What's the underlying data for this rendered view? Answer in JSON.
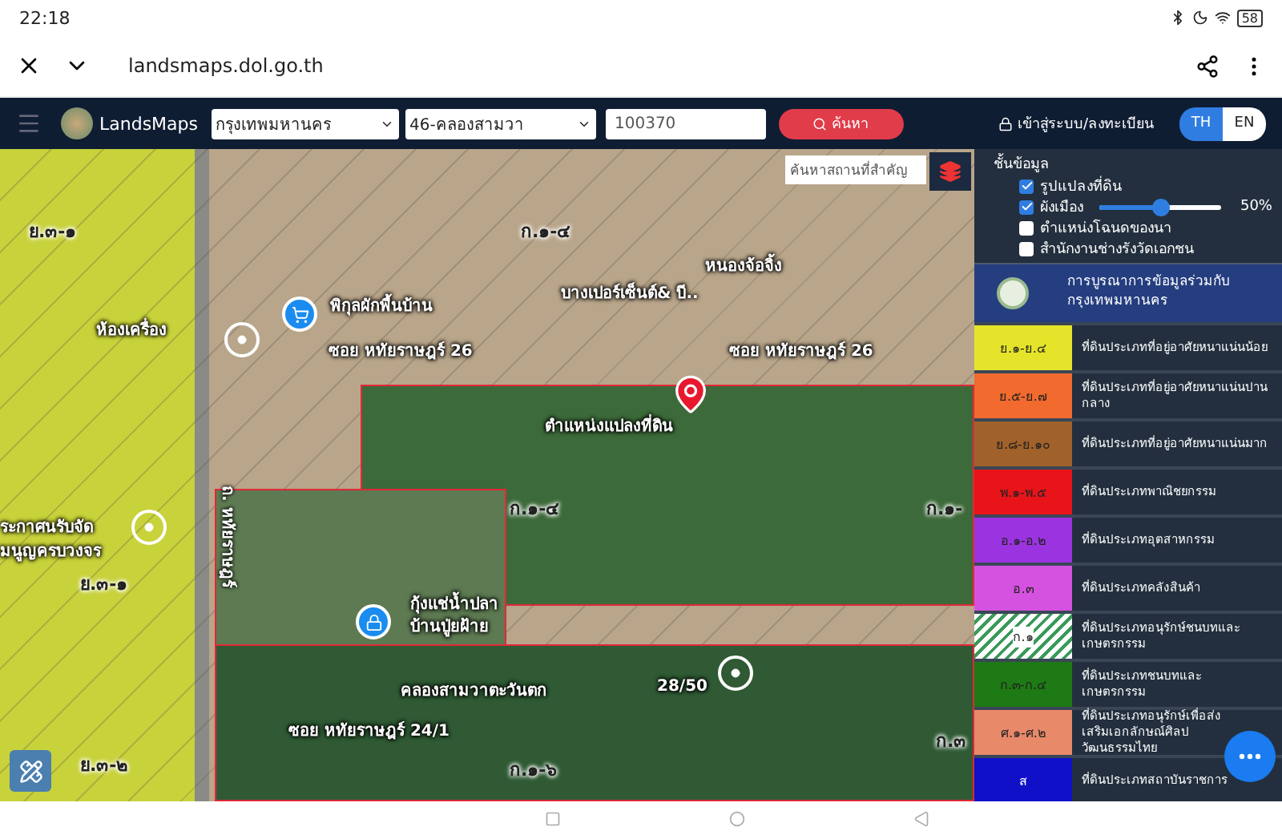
{
  "status_bar": {
    "time": "22:18",
    "battery": "58"
  },
  "browser": {
    "url": "landsmaps.dol.go.th"
  },
  "app_bar": {
    "brand": "LandsMaps",
    "province": "กรุงเทพมหานคร",
    "district": "46-คลองสามวา",
    "parcel_number": "100370",
    "search_button": "ค้นหา",
    "login": "เข้าสู่ระบบ/ลงทะเบียน",
    "languages": [
      {
        "label": "TH",
        "selected": true
      },
      {
        "label": "EN",
        "selected": false
      }
    ]
  },
  "map": {
    "place_search": {
      "placeholder": "ค้นหาสถานที่สำคัญ"
    },
    "labels": [
      {
        "text": "ย.๓-๑",
        "kind": "zone"
      },
      {
        "text": "ก.๑-๔",
        "kind": "zone"
      },
      {
        "text": "ห้องเครื่อง",
        "kind": "place"
      },
      {
        "text": "พิกุลผักพื้นบ้าน",
        "kind": "place"
      },
      {
        "text": "หนองจ้อจิ้ง",
        "kind": "place"
      },
      {
        "text": "บางเปอร์เซ็นต์& บี..",
        "kind": "place"
      },
      {
        "text": "ซอย หทัยราษฎร์ 26",
        "kind": "road"
      },
      {
        "text": "ซอย หทัยราษฎร์ 26",
        "kind": "road"
      },
      {
        "text": "ตำแหน่งแปลงที่ดิน",
        "kind": "place"
      },
      {
        "text": "ระกาศนรับจัด",
        "kind": "place"
      },
      {
        "text": "มนูญครบวงจร",
        "kind": "place"
      },
      {
        "text": "ย.๓-๑",
        "kind": "zone"
      },
      {
        "text": "ก.๑-๔",
        "kind": "zone"
      },
      {
        "text": "ก.๑-",
        "kind": "zone"
      },
      {
        "text": "กุ้งแช่น้ำปลา",
        "kind": "place"
      },
      {
        "text": "บ้านปู่ยฝ้าย",
        "kind": "place"
      },
      {
        "text": "คลองสามวาตะวันตก",
        "kind": "place"
      },
      {
        "text": "28/50",
        "kind": "place"
      },
      {
        "text": "ซอย หทัยราษฎร์ 24/1",
        "kind": "road"
      },
      {
        "text": "ย.๓-๒",
        "kind": "zone"
      },
      {
        "text": "ก.๑-๖",
        "kind": "zone"
      },
      {
        "text": "ก.๓",
        "kind": "zone"
      }
    ],
    "road_label": "ถ. หทัยราษฎร์"
  },
  "layers": {
    "title": "ชั้นข้อมูล",
    "opacity_reading": "50%",
    "items": [
      {
        "label": "รูปแปลงที่ดิน",
        "checked": true,
        "kind": "check"
      },
      {
        "label": "ผังเมือง",
        "checked": true,
        "kind": "slider",
        "level": 0.5
      },
      {
        "label": "ตำแหน่งโฉนดของนา",
        "checked": false,
        "kind": "check"
      },
      {
        "label": "สำนักงานช่างรังวัดเอกชน",
        "checked": false,
        "kind": "check"
      }
    ]
  },
  "legend": {
    "title": "การบูรณาการข้อมูลร่วมกับ กรุงเทพมหานคร",
    "rows": [
      {
        "code": "ย.๑-ย.๔",
        "label": "ที่ดินประเภทที่อยู่อาศัยหนาแน่นน้อย",
        "color": "#e6e42a",
        "kind": "solid"
      },
      {
        "code": "ย.๕-ย.๗",
        "label": "ที่ดินประเภทที่อยู่อาศัยหนาแน่นปานกลาง",
        "color": "#f26a2e",
        "kind": "solid"
      },
      {
        "code": "ย.๘-ย.๑๐",
        "label": "ที่ดินประเภทที่อยู่อาศัยหนาแน่นมาก",
        "color": "#a0612a",
        "kind": "solid"
      },
      {
        "code": "พ.๑-พ.๕",
        "label": "ที่ดินประเภทพาณิชยกรรม",
        "color": "#e8141a",
        "kind": "solid"
      },
      {
        "code": "อ.๑-อ.๒",
        "label": "ที่ดินประเภทอุตสาหกรรม",
        "color": "#9b34e0",
        "kind": "solid"
      },
      {
        "code": "อ.๓",
        "label": "ที่ดินประเภทคลังสินค้า",
        "color": "#d552e0",
        "kind": "solid"
      },
      {
        "code": "ก.๑",
        "label": "ที่ดินประเภทอนุรักษ์ชนบทและเกษตรกรรม",
        "color": "#3a9a5a",
        "kind": "hatched"
      },
      {
        "code": "ก.๓-ก.๔",
        "label": "ที่ดินประเภทชนบทและเกษตรกรรม",
        "color": "#1e7a14",
        "kind": "solid"
      },
      {
        "code": "ศ.๑-ศ.๒",
        "label": "ที่ดินประเภทอนุรักษ์เพื่อส่งเสริมเอกลักษณ์ศิลปวัฒนธรรมไทย",
        "color": "#e8896a",
        "kind": "solid"
      },
      {
        "code": "ส",
        "label": "ที่ดินประเภทสถาบันราชการ",
        "color": "#1010c8",
        "kind": "solid"
      }
    ]
  }
}
